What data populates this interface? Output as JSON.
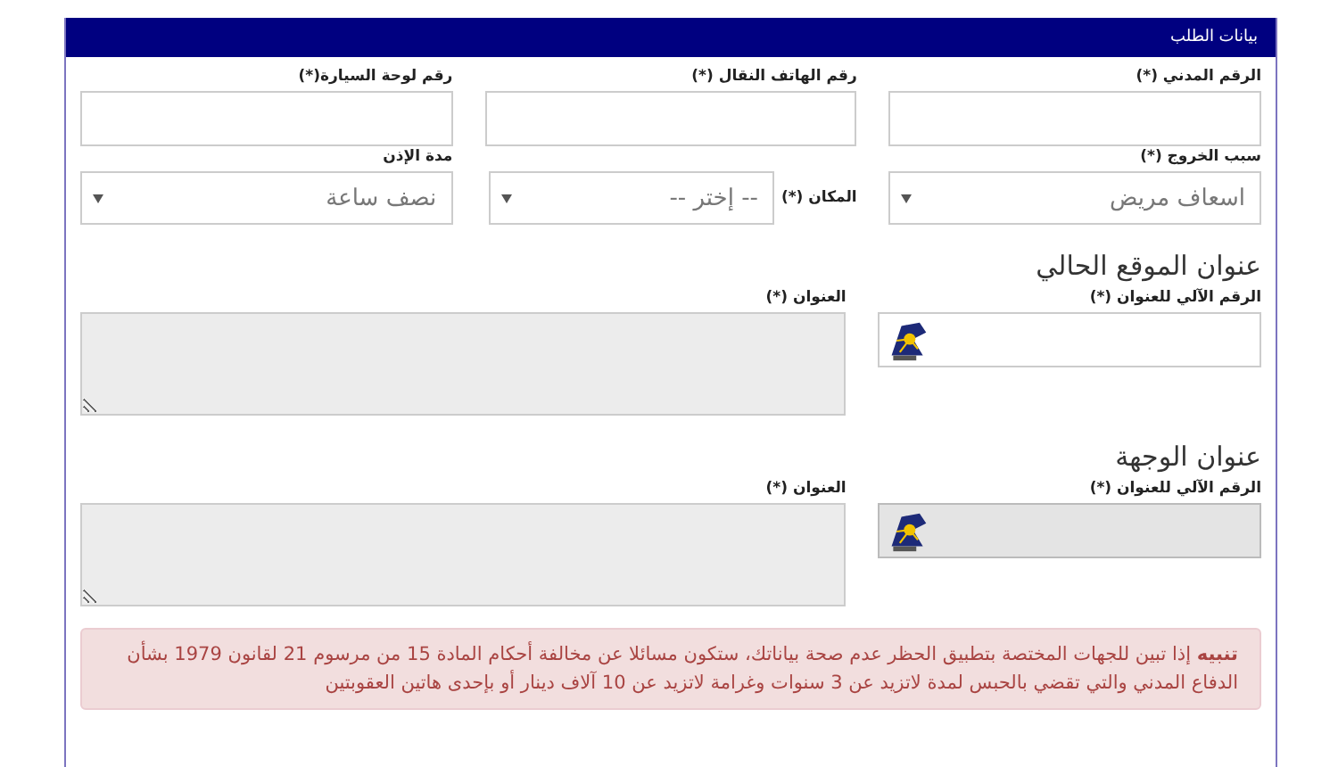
{
  "panel": {
    "title": "بيانات الطلب"
  },
  "fields": [
    {
      "label": "الرقم المدني (*)"
    },
    {
      "label": "رقم الهاتف النقال (*)"
    },
    {
      "label": "رقم لوحة السيارة(*)"
    }
  ],
  "selects": [
    {
      "label": "سبب الخروج (*)",
      "value": "اسعاف مريض",
      "kind": "stacked"
    },
    {
      "label": "المكان (*)",
      "value": "-- إختر --",
      "kind": "inline"
    },
    {
      "label": "مدة الإذن",
      "value": "نصف ساعة",
      "kind": "stacked"
    }
  ],
  "addresses": [
    {
      "title": "عنوان الموقع الحالي",
      "number_label": "الرقم الآلي للعنوان (*)",
      "address_label": "العنوان (*)",
      "disabled": false
    },
    {
      "title": "عنوان الوجهة",
      "number_label": "الرقم الآلي للعنوان (*)",
      "address_label": "العنوان (*)",
      "disabled": true
    }
  ],
  "alert": {
    "text": "**تنبيه** إذا تبين للجهات المختصة بتطبيق الحظر عدم صحة بياناتك، ستكون مسائلا عن مخالفة أحكام المادة 15 من مرسوم 21 لقانون 1979 بشأن الدفاع المدني والتي تقضي بالحبس لمدة لاتزيد عن 3 سنوات وغرامة لاتزيد عن 10 آلاف دينار أو بإحدى هاتين العقوبتين"
  }
}
